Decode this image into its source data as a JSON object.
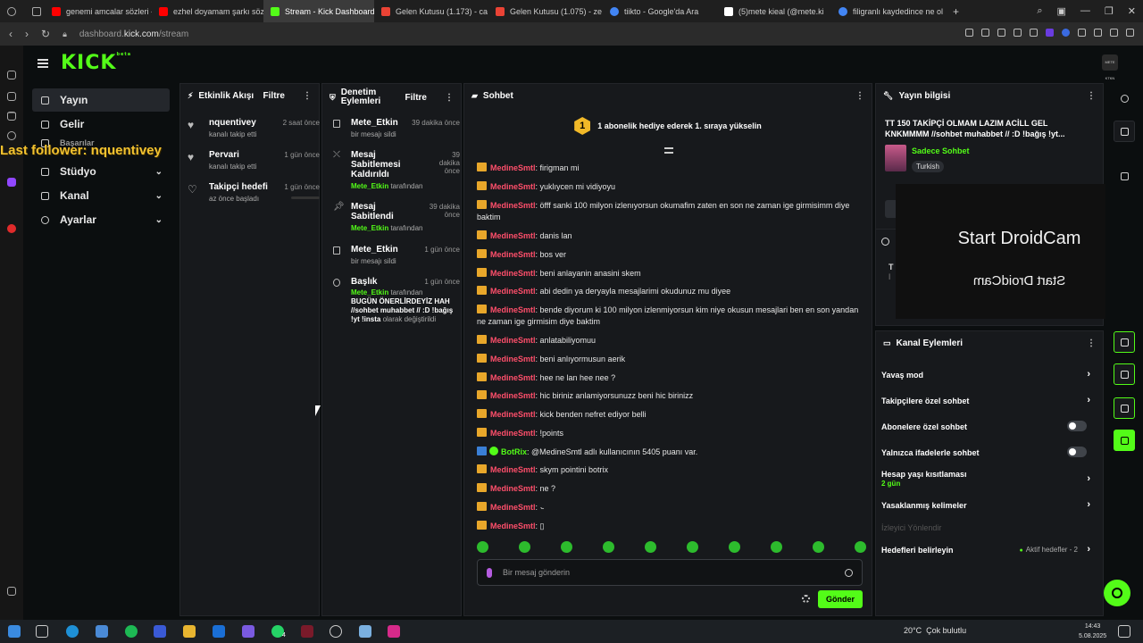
{
  "browser": {
    "tabs": [
      {
        "label": "genemi amcalar sözleri - ",
        "color": "#ff0000"
      },
      {
        "label": "ezhel doyamam şarkı söz",
        "color": "#ff0000"
      },
      {
        "label": "Stream - Kick Dashboard",
        "color": "#53fc18"
      },
      {
        "label": "Gelen Kutusu (1.173) - ca",
        "color": "#ea4335"
      },
      {
        "label": "Gelen Kutusu (1.075) - ze",
        "color": "#ea4335"
      },
      {
        "label": "tiikto - Google'da Ara",
        "color": "#4285f4"
      },
      {
        "label": "(5)mete kieal (@mete.ki",
        "color": "#ffffff"
      },
      {
        "label": "filigranlı kaydedince ne ol",
        "color": "#4285f4"
      }
    ],
    "url_prefix": "dashboard.",
    "url_domain": "kick.com",
    "url_path": "/stream"
  },
  "header": {
    "logo": "KICK",
    "logo_sup": "beta",
    "avatar_text": "METE KTKN"
  },
  "overlay": {
    "last_follower": "Last follower: nquentivey"
  },
  "leftnav": {
    "items": [
      {
        "label": "Yayın"
      },
      {
        "label": "Gelir"
      },
      {
        "label": "Başarılar"
      },
      {
        "label": "Stüdyo"
      },
      {
        "label": "Kanal"
      },
      {
        "label": "Ayarlar"
      }
    ]
  },
  "activity": {
    "title": "Etkinlik Akışı",
    "filter": "Filtre",
    "items": [
      {
        "name": "nquentivey",
        "time": "2 saat önce",
        "sub": "kanalı takip etti"
      },
      {
        "name": "Pervari",
        "time": "1 gün önce",
        "sub": "kanalı takip etti"
      },
      {
        "name": "Takipçi hedefi",
        "time": "1 gün önce",
        "sub": "az önce başladı"
      }
    ]
  },
  "moderation": {
    "title": "Denetim Eylemleri",
    "filter": "Filtre",
    "items": [
      {
        "title": "Mete_Etkin",
        "time": "39 dakika önce",
        "sub": "bir mesajı sildi"
      },
      {
        "title": "Mesaj Sabitlemesi Kaldırıldı",
        "time": "39 dakika önce",
        "user": "Mete_Etkin",
        "by": " tarafından"
      },
      {
        "title": "Mesaj Sabitlendi",
        "time": "39 dakika önce",
        "user": "Mete_Etkin",
        "by": " tarafından"
      },
      {
        "title": "Mete_Etkin",
        "time": "1 gün önce",
        "sub": "bir mesajı sildi"
      },
      {
        "title": "Başlık",
        "time": "1 gün önce",
        "user": "Mete_Etkin",
        "by": " tarafından",
        "strong": "BUGÜN ÖNERLİRDEYİZ HAH //sohbet muhabbet // :D !bağış !yt !insta",
        "after": " olarak değiştirildi"
      }
    ]
  },
  "chat": {
    "title": "Sohbet",
    "pinned_badge": "1",
    "pinned_text": "1 abonelik hediye ederek 1. sıraya yükselin",
    "messages": [
      {
        "user": "MedineSmtl",
        "text": ": firigman mi"
      },
      {
        "user": "MedineSmtl",
        "text": ": yuklıycen mi vidiyoyu"
      },
      {
        "user": "MedineSmtl",
        "text": ": öfff sanki 100 milyon izlenıyorsun okumafim zaten en son ne zaman ige girmisimm diye baktim"
      },
      {
        "user": "MedineSmtl",
        "text": ": danis lan"
      },
      {
        "user": "MedineSmtl",
        "text": ": bos ver"
      },
      {
        "user": "MedineSmtl",
        "text": ": beni anlayanin anasini skem"
      },
      {
        "user": "MedineSmtl",
        "text": ": abi dedin ya deryayla mesajlarimi okudunuz mu diyee"
      },
      {
        "user": "MedineSmtl",
        "text": ": bende diyorum ki 100 milyon izlenmiyorsun kim niye okusun mesajlari ben en son yandan ne zaman ige girmisim diye baktim"
      },
      {
        "user": "MedineSmtl",
        "text": ": anlatabiliyomuu"
      },
      {
        "user": "MedineSmtl",
        "text": ": beni anlıyormusun aerik"
      },
      {
        "user": "MedineSmtl",
        "text": ": hee ne lan hee nee ?"
      },
      {
        "user": "MedineSmtl",
        "text": ": hic biriniz anlamiyorsunuzz beni hic birinizz"
      },
      {
        "user": "MedineSmtl",
        "text": ": kick benden nefret ediyor belli"
      },
      {
        "user": "MedineSmtl",
        "text": ": !points"
      },
      {
        "user": "BotRix",
        "text": ": @MedineSmtl adlı kullanıcının 5405 puanı var."
      },
      {
        "user": "MedineSmtl",
        "text": ": skym pointini botrix"
      },
      {
        "user": "MedineSmtl",
        "text": ": ne ?"
      },
      {
        "user": "MedineSmtl",
        "text": ": ·̵"
      },
      {
        "user": "MedineSmtl",
        "text": ": ▯"
      }
    ],
    "input_placeholder": "Bir mesaj gönderin",
    "send": "Gönder"
  },
  "stream_info": {
    "title_label": "Yayın bilgisi",
    "stream_title": "TT 150 TAKİPÇİ OLMAM LAZIM ACİLL GEL KNKMMMM //sohbet muhabbet // :D !bağış !yt...",
    "category": "Sadece Sohbet",
    "language": "Turkish",
    "partial_t": "T",
    "partial_i": "İ"
  },
  "droidcam": {
    "text": "Start DroidCam",
    "mirrored": "Start DroidCam"
  },
  "channel_actions": {
    "title": "Kanal Eylemleri",
    "rows": [
      {
        "label": "Yavaş mod"
      },
      {
        "label": "Takipçilere özel sohbet"
      },
      {
        "label": "Abonelere özel sohbet"
      },
      {
        "label": "Yalnızca ifadelerle sohbet"
      },
      {
        "label": "Hesap yaşı kısıtlaması",
        "sub": "2 gün"
      },
      {
        "label": "Yasaklanmış kelimeler"
      },
      {
        "label": "İzleyici Yönlendir"
      },
      {
        "label": "Hedefleri belirleyin",
        "goals": "Aktif hedefler - 2"
      }
    ]
  },
  "taskbar": {
    "weather": "20°C",
    "weather_desc": "Çok bulutlu",
    "time": "14:43",
    "date": "5.08.2025",
    "badge": "4"
  }
}
